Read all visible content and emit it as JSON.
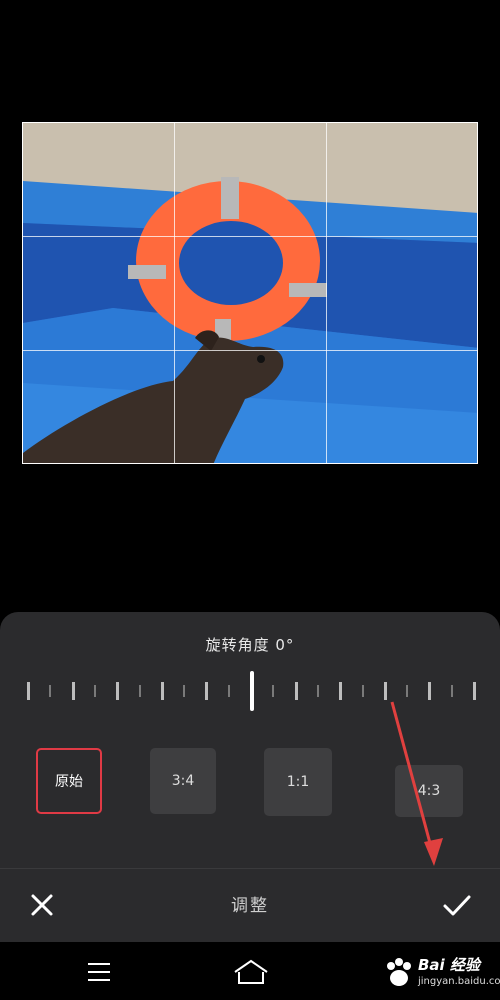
{
  "editor": {
    "angle_label": "旋转角度 0°",
    "title": "调整"
  },
  "ratios": [
    {
      "label": "原始",
      "selected": true
    },
    {
      "label": "3:4",
      "selected": false
    },
    {
      "label": "1:1",
      "selected": false
    },
    {
      "label": "4:3",
      "selected": false
    }
  ],
  "icons": {
    "cancel": "close-icon",
    "confirm": "checkmark-icon",
    "menu": "menu-icon",
    "home": "home-icon"
  },
  "watermark": {
    "text": "Bai 经验",
    "sub": "jingyan.baidu.com"
  },
  "colors": {
    "selected_border": "#e03a45",
    "annotation_arrow": "#e0403f"
  }
}
